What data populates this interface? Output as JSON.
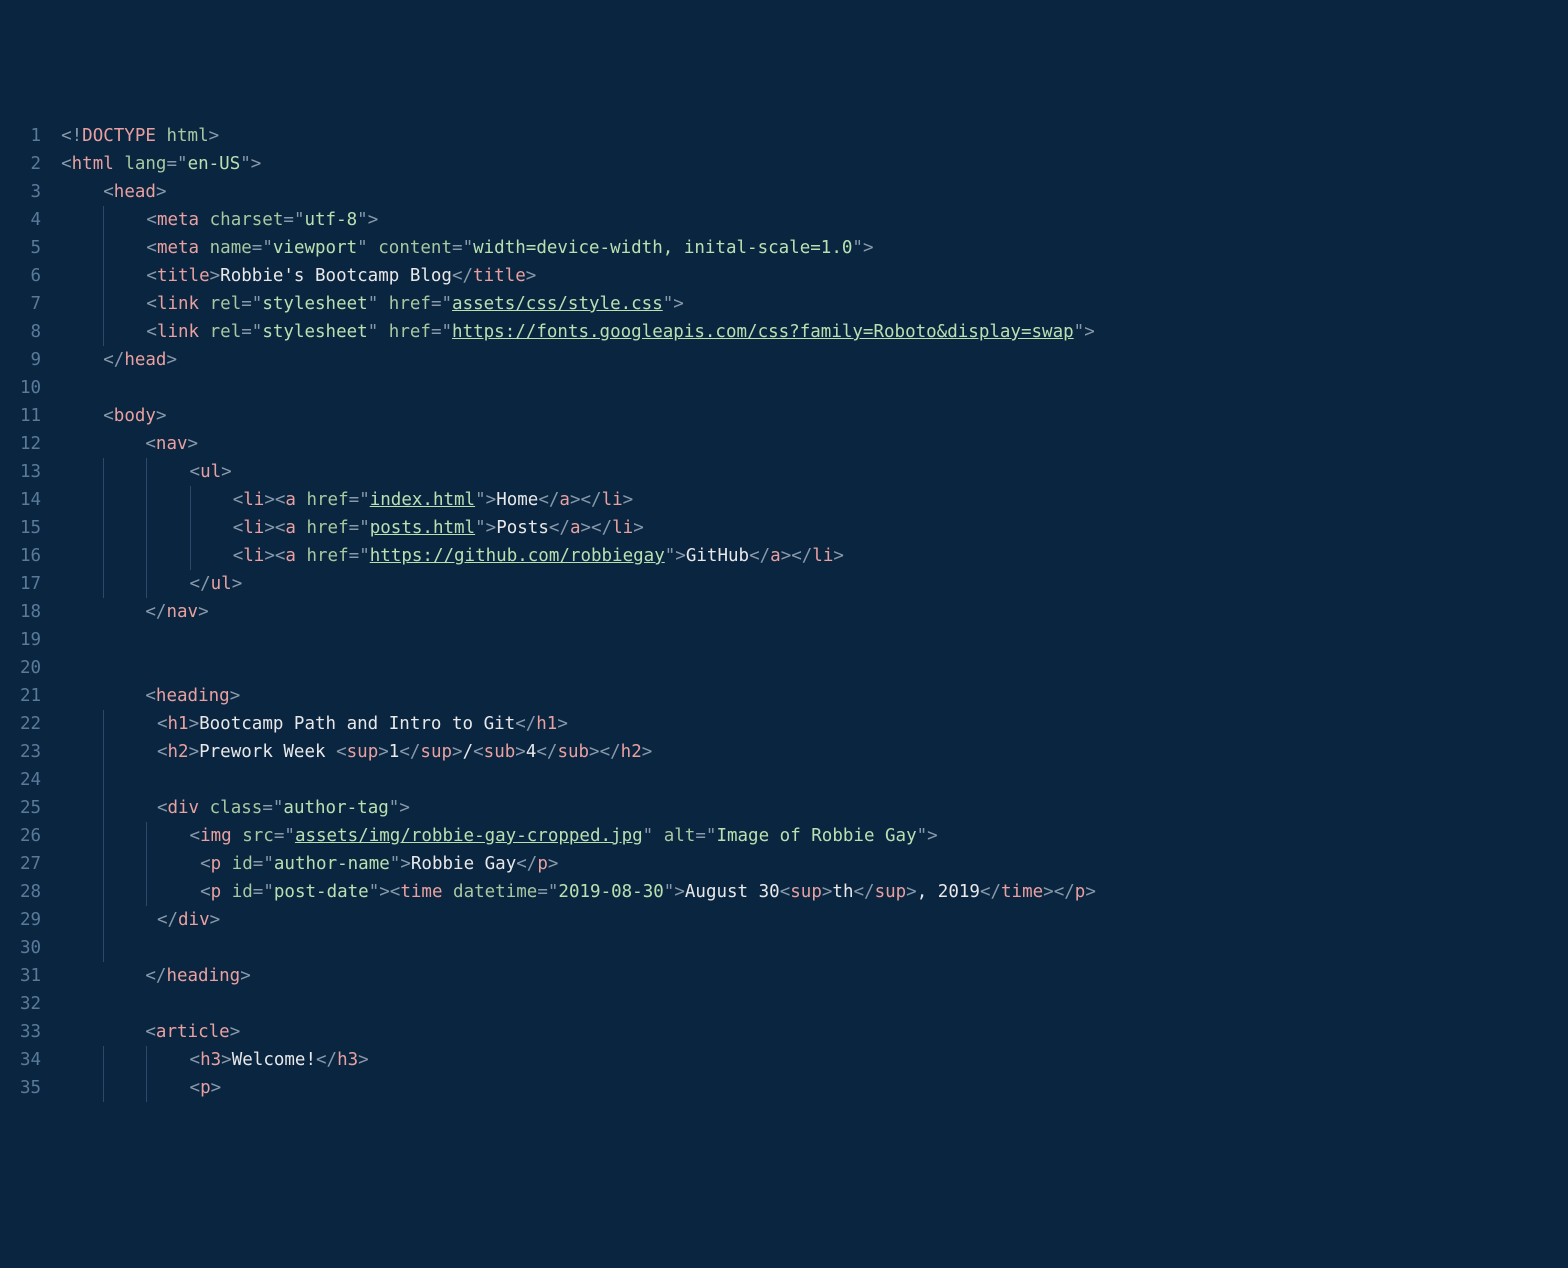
{
  "lines": [
    {
      "num": "1",
      "indent": 0,
      "tokens": [
        {
          "c": "p",
          "t": "<!"
        },
        {
          "c": "t",
          "t": "DOCTYPE"
        },
        {
          "c": "a",
          "t": " html"
        },
        {
          "c": "p",
          "t": ">"
        }
      ]
    },
    {
      "num": "2",
      "indent": 0,
      "tokens": [
        {
          "c": "p",
          "t": "<"
        },
        {
          "c": "t",
          "t": "html"
        },
        {
          "c": "a",
          "t": " lang"
        },
        {
          "c": "p",
          "t": "="
        },
        {
          "c": "p",
          "t": "\""
        },
        {
          "c": "s",
          "t": "en-US"
        },
        {
          "c": "p",
          "t": "\""
        },
        {
          "c": "p",
          "t": ">"
        }
      ]
    },
    {
      "num": "3",
      "indent": 1,
      "tokens": [
        {
          "c": "p",
          "t": "<"
        },
        {
          "c": "t",
          "t": "head"
        },
        {
          "c": "p",
          "t": ">"
        }
      ]
    },
    {
      "num": "4",
      "indent": 2,
      "g": 1,
      "tokens": [
        {
          "c": "p",
          "t": "<"
        },
        {
          "c": "t",
          "t": "meta"
        },
        {
          "c": "a",
          "t": " charset"
        },
        {
          "c": "p",
          "t": "="
        },
        {
          "c": "p",
          "t": "\""
        },
        {
          "c": "s",
          "t": "utf-8"
        },
        {
          "c": "p",
          "t": "\""
        },
        {
          "c": "p",
          "t": ">"
        }
      ]
    },
    {
      "num": "5",
      "indent": 2,
      "g": 1,
      "tokens": [
        {
          "c": "p",
          "t": "<"
        },
        {
          "c": "t",
          "t": "meta"
        },
        {
          "c": "a",
          "t": " name"
        },
        {
          "c": "p",
          "t": "="
        },
        {
          "c": "p",
          "t": "\""
        },
        {
          "c": "s",
          "t": "viewport"
        },
        {
          "c": "p",
          "t": "\""
        },
        {
          "c": "a",
          "t": " content"
        },
        {
          "c": "p",
          "t": "="
        },
        {
          "c": "p",
          "t": "\""
        },
        {
          "c": "s",
          "t": "width=device-width, inital-scale=1.0"
        },
        {
          "c": "p",
          "t": "\""
        },
        {
          "c": "p",
          "t": ">"
        }
      ]
    },
    {
      "num": "6",
      "indent": 2,
      "g": 1,
      "tokens": [
        {
          "c": "p",
          "t": "<"
        },
        {
          "c": "t",
          "t": "title"
        },
        {
          "c": "p",
          "t": ">"
        },
        {
          "c": "tx",
          "t": "Robbie's Bootcamp Blog"
        },
        {
          "c": "p",
          "t": "</"
        },
        {
          "c": "t",
          "t": "title"
        },
        {
          "c": "p",
          "t": ">"
        }
      ]
    },
    {
      "num": "7",
      "indent": 2,
      "g": 1,
      "tokens": [
        {
          "c": "p",
          "t": "<"
        },
        {
          "c": "t",
          "t": "link"
        },
        {
          "c": "a",
          "t": " rel"
        },
        {
          "c": "p",
          "t": "="
        },
        {
          "c": "p",
          "t": "\""
        },
        {
          "c": "s",
          "t": "stylesheet"
        },
        {
          "c": "p",
          "t": "\""
        },
        {
          "c": "a",
          "t": " href"
        },
        {
          "c": "p",
          "t": "="
        },
        {
          "c": "p",
          "t": "\""
        },
        {
          "c": "su",
          "t": "assets/css/style.css"
        },
        {
          "c": "p",
          "t": "\""
        },
        {
          "c": "p",
          "t": ">"
        }
      ]
    },
    {
      "num": "8",
      "indent": 2,
      "g": 1,
      "tokens": [
        {
          "c": "p",
          "t": "<"
        },
        {
          "c": "t",
          "t": "link"
        },
        {
          "c": "a",
          "t": " rel"
        },
        {
          "c": "p",
          "t": "="
        },
        {
          "c": "p",
          "t": "\""
        },
        {
          "c": "s",
          "t": "stylesheet"
        },
        {
          "c": "p",
          "t": "\""
        },
        {
          "c": "a",
          "t": " href"
        },
        {
          "c": "p",
          "t": "="
        },
        {
          "c": "p",
          "t": "\""
        },
        {
          "c": "su",
          "t": "https://fonts.googleapis.com/css?family=Roboto&display=swap"
        },
        {
          "c": "p",
          "t": "\""
        },
        {
          "c": "p",
          "t": ">"
        }
      ]
    },
    {
      "num": "9",
      "indent": 1,
      "tokens": [
        {
          "c": "p",
          "t": "</"
        },
        {
          "c": "t",
          "t": "head"
        },
        {
          "c": "p",
          "t": ">"
        }
      ]
    },
    {
      "num": "10",
      "indent": 0,
      "tokens": []
    },
    {
      "num": "11",
      "indent": 1,
      "tokens": [
        {
          "c": "p",
          "t": "<"
        },
        {
          "c": "t",
          "t": "body"
        },
        {
          "c": "p",
          "t": ">"
        }
      ]
    },
    {
      "num": "12",
      "indent": 2,
      "tokens": [
        {
          "c": "p",
          "t": "<"
        },
        {
          "c": "t",
          "t": "nav"
        },
        {
          "c": "p",
          "t": ">"
        }
      ]
    },
    {
      "num": "13",
      "indent": 3,
      "g": 2,
      "tokens": [
        {
          "c": "p",
          "t": "<"
        },
        {
          "c": "t",
          "t": "ul"
        },
        {
          "c": "p",
          "t": ">"
        }
      ]
    },
    {
      "num": "14",
      "indent": 4,
      "g": 3,
      "tokens": [
        {
          "c": "p",
          "t": "<"
        },
        {
          "c": "t",
          "t": "li"
        },
        {
          "c": "p",
          "t": "><"
        },
        {
          "c": "t",
          "t": "a"
        },
        {
          "c": "a",
          "t": " href"
        },
        {
          "c": "p",
          "t": "="
        },
        {
          "c": "p",
          "t": "\""
        },
        {
          "c": "su",
          "t": "index.html"
        },
        {
          "c": "p",
          "t": "\""
        },
        {
          "c": "p",
          "t": ">"
        },
        {
          "c": "tx",
          "t": "Home"
        },
        {
          "c": "p",
          "t": "</"
        },
        {
          "c": "t",
          "t": "a"
        },
        {
          "c": "p",
          "t": "></"
        },
        {
          "c": "t",
          "t": "li"
        },
        {
          "c": "p",
          "t": ">"
        }
      ]
    },
    {
      "num": "15",
      "indent": 4,
      "g": 3,
      "tokens": [
        {
          "c": "p",
          "t": "<"
        },
        {
          "c": "t",
          "t": "li"
        },
        {
          "c": "p",
          "t": "><"
        },
        {
          "c": "t",
          "t": "a"
        },
        {
          "c": "a",
          "t": " href"
        },
        {
          "c": "p",
          "t": "="
        },
        {
          "c": "p",
          "t": "\""
        },
        {
          "c": "su",
          "t": "posts.html"
        },
        {
          "c": "p",
          "t": "\""
        },
        {
          "c": "p",
          "t": ">"
        },
        {
          "c": "tx",
          "t": "Posts"
        },
        {
          "c": "p",
          "t": "</"
        },
        {
          "c": "t",
          "t": "a"
        },
        {
          "c": "p",
          "t": "></"
        },
        {
          "c": "t",
          "t": "li"
        },
        {
          "c": "p",
          "t": ">"
        }
      ]
    },
    {
      "num": "16",
      "indent": 4,
      "g": 3,
      "tokens": [
        {
          "c": "p",
          "t": "<"
        },
        {
          "c": "t",
          "t": "li"
        },
        {
          "c": "p",
          "t": "><"
        },
        {
          "c": "t",
          "t": "a"
        },
        {
          "c": "a",
          "t": " href"
        },
        {
          "c": "p",
          "t": "="
        },
        {
          "c": "p",
          "t": "\""
        },
        {
          "c": "su",
          "t": "https://github.com/robbiegay"
        },
        {
          "c": "p",
          "t": "\""
        },
        {
          "c": "p",
          "t": ">"
        },
        {
          "c": "tx",
          "t": "GitHub"
        },
        {
          "c": "p",
          "t": "</"
        },
        {
          "c": "t",
          "t": "a"
        },
        {
          "c": "p",
          "t": "></"
        },
        {
          "c": "t",
          "t": "li"
        },
        {
          "c": "p",
          "t": ">"
        }
      ]
    },
    {
      "num": "17",
      "indent": 3,
      "g": 2,
      "tokens": [
        {
          "c": "p",
          "t": "</"
        },
        {
          "c": "t",
          "t": "ul"
        },
        {
          "c": "p",
          "t": ">"
        }
      ]
    },
    {
      "num": "18",
      "indent": 2,
      "tokens": [
        {
          "c": "p",
          "t": "</"
        },
        {
          "c": "t",
          "t": "nav"
        },
        {
          "c": "p",
          "t": ">"
        }
      ]
    },
    {
      "num": "19",
      "indent": 0,
      "tokens": []
    },
    {
      "num": "20",
      "indent": 0,
      "tokens": []
    },
    {
      "num": "21",
      "indent": 2,
      "tokens": [
        {
          "c": "p",
          "t": "<"
        },
        {
          "c": "t",
          "t": "heading"
        },
        {
          "c": "p",
          "t": ">"
        }
      ]
    },
    {
      "num": "22",
      "indent": 2,
      "g": 2,
      "go": 1,
      "tokens": [
        {
          "c": "p",
          "t": "<"
        },
        {
          "c": "t",
          "t": "h1"
        },
        {
          "c": "p",
          "t": ">"
        },
        {
          "c": "tx",
          "t": "Bootcamp Path and Intro to Git"
        },
        {
          "c": "p",
          "t": "</"
        },
        {
          "c": "t",
          "t": "h1"
        },
        {
          "c": "p",
          "t": ">"
        }
      ]
    },
    {
      "num": "23",
      "indent": 2,
      "g": 2,
      "go": 1,
      "tokens": [
        {
          "c": "p",
          "t": "<"
        },
        {
          "c": "t",
          "t": "h2"
        },
        {
          "c": "p",
          "t": ">"
        },
        {
          "c": "tx",
          "t": "Prework Week "
        },
        {
          "c": "p",
          "t": "<"
        },
        {
          "c": "t",
          "t": "sup"
        },
        {
          "c": "p",
          "t": ">"
        },
        {
          "c": "tx",
          "t": "1"
        },
        {
          "c": "p",
          "t": "</"
        },
        {
          "c": "t",
          "t": "sup"
        },
        {
          "c": "p",
          "t": ">"
        },
        {
          "c": "tx",
          "t": "/"
        },
        {
          "c": "p",
          "t": "<"
        },
        {
          "c": "t",
          "t": "sub"
        },
        {
          "c": "p",
          "t": ">"
        },
        {
          "c": "tx",
          "t": "4"
        },
        {
          "c": "p",
          "t": "</"
        },
        {
          "c": "t",
          "t": "sub"
        },
        {
          "c": "p",
          "t": "></"
        },
        {
          "c": "t",
          "t": "h2"
        },
        {
          "c": "p",
          "t": ">"
        }
      ]
    },
    {
      "num": "24",
      "indent": 2,
      "g": 2,
      "tokens": []
    },
    {
      "num": "25",
      "indent": 2,
      "g": 2,
      "go": 1,
      "tokens": [
        {
          "c": "p",
          "t": "<"
        },
        {
          "c": "t",
          "t": "div"
        },
        {
          "c": "a",
          "t": " class"
        },
        {
          "c": "p",
          "t": "="
        },
        {
          "c": "p",
          "t": "\""
        },
        {
          "c": "s",
          "t": "author-tag"
        },
        {
          "c": "p",
          "t": "\""
        },
        {
          "c": "p",
          "t": ">"
        }
      ]
    },
    {
      "num": "26",
      "indent": 3,
      "g": 2,
      "tokens": [
        {
          "c": "p",
          "t": "<"
        },
        {
          "c": "t",
          "t": "img"
        },
        {
          "c": "a",
          "t": " src"
        },
        {
          "c": "p",
          "t": "="
        },
        {
          "c": "p",
          "t": "\""
        },
        {
          "c": "su",
          "t": "assets/img/robbie-gay-cropped.jpg"
        },
        {
          "c": "p",
          "t": "\""
        },
        {
          "c": "a",
          "t": " alt"
        },
        {
          "c": "p",
          "t": "="
        },
        {
          "c": "p",
          "t": "\""
        },
        {
          "c": "s",
          "t": "Image of Robbie Gay"
        },
        {
          "c": "p",
          "t": "\""
        },
        {
          "c": "p",
          "t": ">"
        }
      ]
    },
    {
      "num": "27",
      "indent": 3,
      "g": 3,
      "go": 1,
      "tokens": [
        {
          "c": "p",
          "t": "<"
        },
        {
          "c": "t",
          "t": "p"
        },
        {
          "c": "a",
          "t": " id"
        },
        {
          "c": "p",
          "t": "="
        },
        {
          "c": "p",
          "t": "\""
        },
        {
          "c": "s",
          "t": "author-name"
        },
        {
          "c": "p",
          "t": "\""
        },
        {
          "c": "p",
          "t": ">"
        },
        {
          "c": "tx",
          "t": "Robbie Gay"
        },
        {
          "c": "p",
          "t": "</"
        },
        {
          "c": "t",
          "t": "p"
        },
        {
          "c": "p",
          "t": ">"
        }
      ]
    },
    {
      "num": "28",
      "indent": 3,
      "g": 3,
      "go": 1,
      "tokens": [
        {
          "c": "p",
          "t": "<"
        },
        {
          "c": "t",
          "t": "p"
        },
        {
          "c": "a",
          "t": " id"
        },
        {
          "c": "p",
          "t": "="
        },
        {
          "c": "p",
          "t": "\""
        },
        {
          "c": "s",
          "t": "post-date"
        },
        {
          "c": "p",
          "t": "\""
        },
        {
          "c": "p",
          "t": "><"
        },
        {
          "c": "t",
          "t": "time"
        },
        {
          "c": "a",
          "t": " datetime"
        },
        {
          "c": "p",
          "t": "="
        },
        {
          "c": "p",
          "t": "\""
        },
        {
          "c": "s",
          "t": "2019-08-30"
        },
        {
          "c": "p",
          "t": "\""
        },
        {
          "c": "p",
          "t": ">"
        },
        {
          "c": "tx",
          "t": "August 30"
        },
        {
          "c": "p",
          "t": "<"
        },
        {
          "c": "t",
          "t": "sup"
        },
        {
          "c": "p",
          "t": ">"
        },
        {
          "c": "tx",
          "t": "th"
        },
        {
          "c": "p",
          "t": "</"
        },
        {
          "c": "t",
          "t": "sup"
        },
        {
          "c": "p",
          "t": ">"
        },
        {
          "c": "tx",
          "t": ", 2019"
        },
        {
          "c": "p",
          "t": "</"
        },
        {
          "c": "t",
          "t": "time"
        },
        {
          "c": "p",
          "t": "></"
        },
        {
          "c": "t",
          "t": "p"
        },
        {
          "c": "p",
          "t": ">"
        }
      ]
    },
    {
      "num": "29",
      "indent": 2,
      "g": 2,
      "go": 1,
      "tokens": [
        {
          "c": "p",
          "t": "</"
        },
        {
          "c": "t",
          "t": "div"
        },
        {
          "c": "p",
          "t": ">"
        }
      ]
    },
    {
      "num": "30",
      "indent": 2,
      "g": 2,
      "tokens": []
    },
    {
      "num": "31",
      "indent": 2,
      "tokens": [
        {
          "c": "p",
          "t": "</"
        },
        {
          "c": "t",
          "t": "heading"
        },
        {
          "c": "p",
          "t": ">"
        }
      ]
    },
    {
      "num": "32",
      "indent": 0,
      "tokens": []
    },
    {
      "num": "33",
      "indent": 2,
      "tokens": [
        {
          "c": "p",
          "t": "<"
        },
        {
          "c": "t",
          "t": "article"
        },
        {
          "c": "p",
          "t": ">"
        }
      ]
    },
    {
      "num": "34",
      "indent": 3,
      "g": 2,
      "tokens": [
        {
          "c": "p",
          "t": "<"
        },
        {
          "c": "t",
          "t": "h3"
        },
        {
          "c": "p",
          "t": ">"
        },
        {
          "c": "tx",
          "t": "Welcome!"
        },
        {
          "c": "p",
          "t": "</"
        },
        {
          "c": "t",
          "t": "h3"
        },
        {
          "c": "p",
          "t": ">"
        }
      ]
    },
    {
      "num": "35",
      "indent": 3,
      "g": 2,
      "tokens": [
        {
          "c": "p",
          "t": "<"
        },
        {
          "c": "t",
          "t": "p"
        },
        {
          "c": "p",
          "t": ">"
        }
      ]
    }
  ],
  "colors": {
    "bg": "#0a2540"
  }
}
